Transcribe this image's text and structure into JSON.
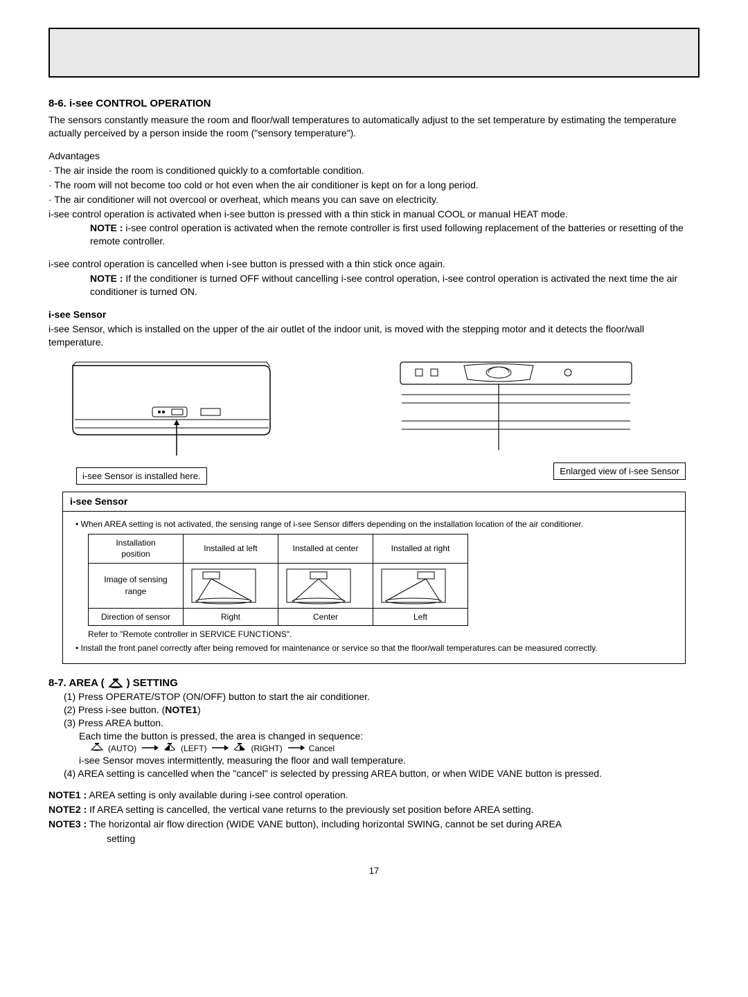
{
  "section86": {
    "heading": "8-6. i-see CONTROL OPERATION",
    "intro": "The sensors constantly measure the room and floor/wall temperatures to automatically adjust to the set temperature by estimating the temperature actually perceived by a person inside the room (\"sensory temperature\").",
    "adv_label": "Advantages",
    "adv1": "· The air inside the room is conditioned quickly to a comfortable condition.",
    "adv2": "· The room will not become too cold or hot even when the air conditioner is kept on for a long period.",
    "adv3": "· The air conditioner will not overcool or overheat, which means you can save on electricity.",
    "activate": "i-see control operation is activated when i-see button is pressed with a thin stick in manual COOL or manual HEAT mode.",
    "note1_label": "NOTE :",
    "note1": "i-see control operation is activated when the remote controller is first used following replacement of the batteries or resetting of the remote controller.",
    "cancel": "i-see control operation is cancelled when i-see button is pressed with a thin stick once again.",
    "note2_label": "NOTE :",
    "note2": "If the conditioner is turned OFF without  cancelling i-see control operation, i-see control operation is activated the next time the air conditioner is turned ON.",
    "isee_heading": "i-see Sensor",
    "isee_desc": "i-see Sensor, which is installed on the upper of the air outlet of the indoor unit, is moved with the stepping motor and it detects the floor/wall temperature.",
    "fig_left_label": "i-see Sensor is installed here.",
    "fig_right_label": "Enlarged view of i-see Sensor"
  },
  "sensorBox": {
    "title": "i-see Sensor",
    "bullet1": "• When AREA setting is not activated, the sensing range of i-see Sensor differs depending on the installation location of the air conditioner.",
    "tbl": {
      "r1c1a": "Installation",
      "r1c1b": "position",
      "r1c2": "Installed at left",
      "r1c3": "Installed at center",
      "r1c4": "Installed at right",
      "r2c1a": "Image of sensing",
      "r2c1b": "range",
      "r3c1": "Direction of sensor",
      "r3c2": "Right",
      "r3c3": "Center",
      "r3c4": "Left"
    },
    "refer": "Refer to \"Remote controller in SERVICE FUNCTIONS\".",
    "bullet2": "• Install the front panel correctly after being removed for maintenance or service so that the floor/wall temperatures can be measured correctly."
  },
  "section87": {
    "heading_pre": "8-7. AREA (",
    "heading_post": ") SETTING",
    "step1": "(1) Press OPERATE/STOP (ON/OFF) button to start the air conditioner.",
    "step2_pre": "(2) Press i-see button. (",
    "step2_bold": "NOTE1",
    "step2_post": ")",
    "step3": "(3) Press AREA button.",
    "step3a": "Each time the button is pressed, the area is changed in sequence:",
    "seq_auto": "(AUTO)",
    "seq_left": "(LEFT)",
    "seq_right": "(RIGHT)",
    "seq_cancel": "Cancel",
    "step3b": "i-see Sensor moves intermittently, measuring the floor and wall temperature.",
    "step4": "(4) AREA setting is cancelled when the \"cancel\" is selected by pressing AREA button, or when WIDE VANE button is pressed.",
    "note1_label": "NOTE1 :",
    "note1": "AREA setting is only available during i-see control operation.",
    "note2_label": "NOTE2 :",
    "note2": "If AREA setting is cancelled, the vertical vane returns to the previously set position before AREA setting.",
    "note3_label": "NOTE3 :",
    "note3a": "The horizontal air flow direction (WIDE VANE button), including horizontal SWING, cannot be set during AREA",
    "note3b": "setting"
  },
  "page_num": "17"
}
